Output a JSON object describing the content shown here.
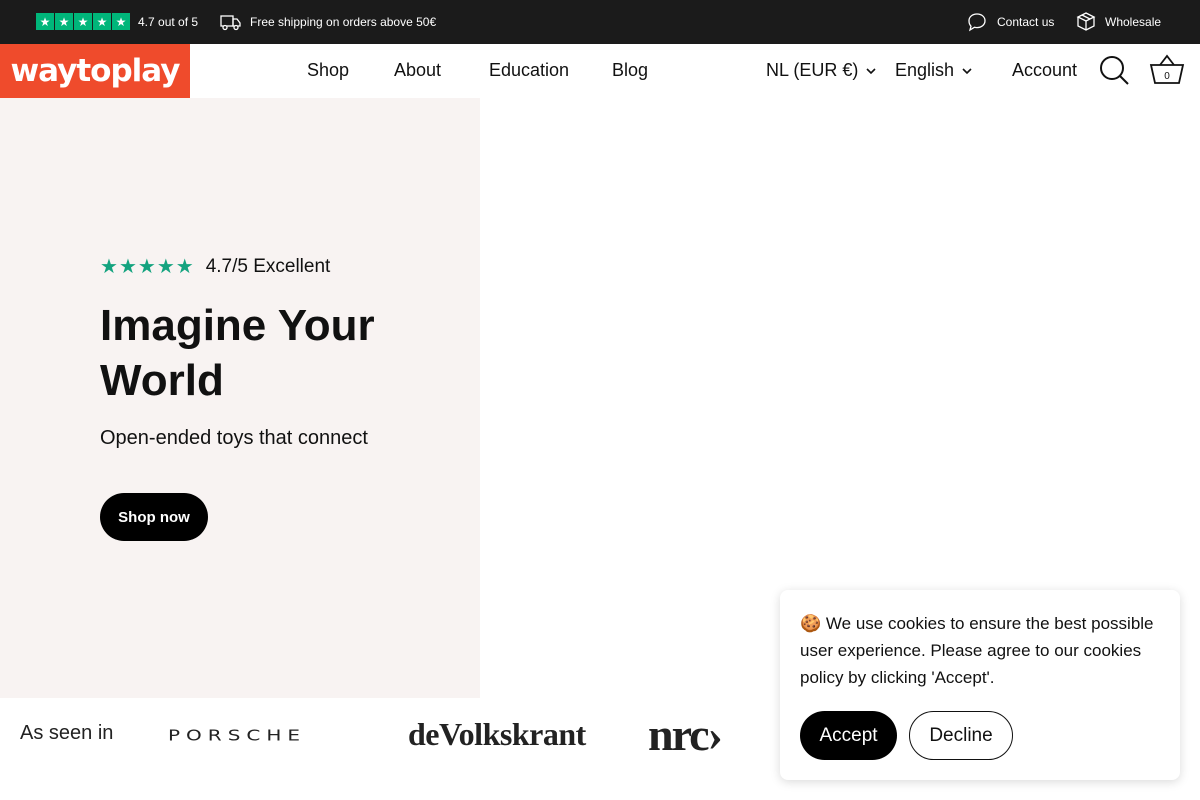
{
  "topbar": {
    "rating_text": "4.7 out of 5",
    "rating_stars": 5,
    "shipping_text": "Free shipping on orders above 50€",
    "contact_text": "Contact us",
    "wholesale_text": "Wholesale",
    "icons": [
      "trustpilot-star-icon",
      "truck-icon",
      "chat-bubble-icon",
      "box-icon"
    ]
  },
  "header": {
    "logo_text": "waytoplay",
    "nav": [
      "Shop",
      "About",
      "Education",
      "Blog"
    ],
    "currency": "NL (EUR €)",
    "language": "English",
    "account": "Account",
    "cart_count": "0",
    "icons": [
      "chevron-down-icon",
      "search-icon",
      "basket-icon"
    ]
  },
  "hero": {
    "rating_text": "4.7/5 Excellent",
    "rating_stars": 5,
    "title": "Imagine Your World",
    "subtitle": "Open-ended toys that connect",
    "cta": "Shop now"
  },
  "press": {
    "label": "As seen in",
    "logos": [
      "PORSCHE",
      "deVolkskrant",
      "nrc›"
    ]
  },
  "cookie": {
    "emoji": "🍪",
    "message": "We use cookies to ensure the best possible user experience. Please agree to our cookies policy by clicking 'Accept'.",
    "accept": "Accept",
    "decline": "Decline"
  },
  "colors": {
    "topbar_bg": "#1b1b1b",
    "logo_bg": "#ef4b2c",
    "trustpilot_green": "#00b67a",
    "hero_star_green": "#14a37f",
    "hero_bg": "#f8f3f2"
  }
}
